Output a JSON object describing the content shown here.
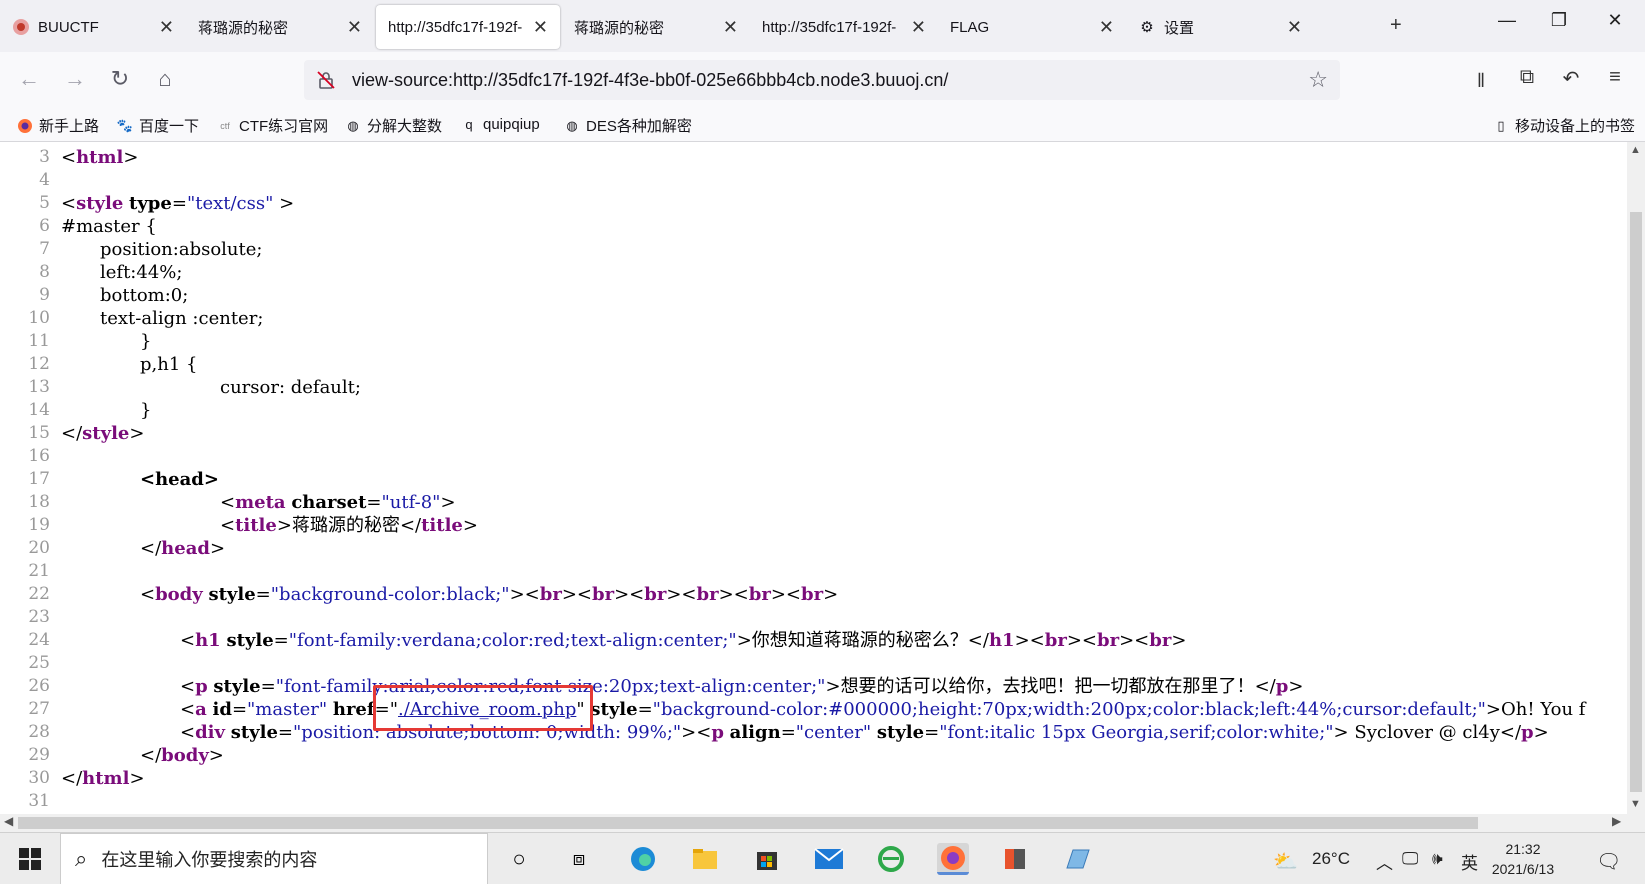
{
  "tabs": [
    {
      "title": "BUUCTF",
      "favicon": "buuctf-icon"
    },
    {
      "title": "蒋璐源的秘密",
      "favicon": ""
    },
    {
      "title": "http://35dfc17f-192f-",
      "favicon": "",
      "active": true
    },
    {
      "title": "蒋璐源的秘密",
      "favicon": ""
    },
    {
      "title": "http://35dfc17f-192f-",
      "favicon": ""
    },
    {
      "title": "FLAG",
      "favicon": ""
    },
    {
      "title": "设置",
      "favicon": "gear-icon"
    }
  ],
  "new_tab": "+",
  "url": "view-source:http://35dfc17f-192f-4f3e-bb0f-025e66bbb4cb.node3.buuoj.cn/",
  "bookmarks": [
    {
      "label": "新手上路",
      "icon": "firefox-icon"
    },
    {
      "label": "百度一下",
      "icon": "baidu-icon"
    },
    {
      "label": "CTF练习官网",
      "icon": "ctf-icon"
    },
    {
      "label": "分解大整数",
      "icon": "globe-icon"
    },
    {
      "label": "quipqiup",
      "icon": "q-icon"
    },
    {
      "label": "DES各种加解密",
      "icon": "globe-icon"
    }
  ],
  "mobile_bookmarks": "移动设备上的书签",
  "source_lines": {
    "l3": {
      "num": "3"
    },
    "l4": {
      "num": "4"
    },
    "l5": {
      "num": "5",
      "style_open": "style",
      "type_attr": "type",
      "type_val": "\"text/css\""
    },
    "l6": {
      "num": "6",
      "text": "#master {"
    },
    "l7": {
      "num": "7",
      "text": "position:absolute;"
    },
    "l8": {
      "num": "8",
      "text": "left:44%;"
    },
    "l9": {
      "num": "9",
      "text": "bottom:0;"
    },
    "l10": {
      "num": "10",
      "text": "text-align :center;"
    },
    "l11": {
      "num": "11",
      "text": "}"
    },
    "l12": {
      "num": "12",
      "text": "p,h1 {"
    },
    "l13": {
      "num": "13",
      "text": "cursor: default;"
    },
    "l14": {
      "num": "14",
      "text": "}"
    },
    "l15": {
      "num": "15",
      "text": "style"
    },
    "l16": {
      "num": "16"
    },
    "l17": {
      "num": "17",
      "text": "head"
    },
    "l18": {
      "num": "18",
      "tag": "meta",
      "attr": "charset",
      "val": "\"utf-8\""
    },
    "l19": {
      "num": "19",
      "tag": "title",
      "text": "蒋璐源的秘密"
    },
    "l20": {
      "num": "20",
      "text": "head"
    },
    "l21": {
      "num": "21"
    },
    "l22": {
      "num": "22",
      "tag": "body",
      "attr": "style",
      "val": "\"background-color:black;\"",
      "br": "br"
    },
    "l23": {
      "num": "23"
    },
    "l24": {
      "num": "24",
      "tag": "h1",
      "attr": "style",
      "val": "\"font-family:verdana;color:red;text-align:center;\"",
      "text": "你想知道蒋璐源的秘密么？"
    },
    "l25": {
      "num": "25"
    },
    "l26": {
      "num": "26",
      "tag": "p",
      "attr": "style",
      "val": "\"font-family:arial;color:red;font-size:20px;text-align:center;\"",
      "text": "想要的话可以给你，去找吧！把一切都放在那里了！"
    },
    "l27": {
      "num": "27",
      "tag": "a",
      "id_attr": "id",
      "id_val": "\"master\"",
      "href_attr": "href",
      "href_val": "./Archive_room.php",
      "style_attr": "style",
      "style_val": "\"background-color:#000000;height:70px;width:200px;color:black;left:44%;cursor:default;\"",
      "text": "Oh! You f"
    },
    "l28": {
      "num": "28",
      "tag": "div",
      "attr": "style",
      "val": "\"position: absolute;bottom: 0;width: 99%;\"",
      "p_align_attr": "align",
      "p_align_val": "\"center\"",
      "p_style_attr": "style",
      "p_style_val": "\"font:italic 15px Georgia,serif;color:white;\"",
      "text": " Syclover @ cl4y"
    },
    "l29": {
      "num": "29",
      "text": "body"
    },
    "l30": {
      "num": "30",
      "text": "html"
    },
    "l31": {
      "num": "31"
    }
  },
  "taskbar": {
    "search_placeholder": "在这里输入你要搜索的内容",
    "weather": "26°C",
    "ime": "英",
    "time": "21:32",
    "date": "2021/6/13"
  },
  "colors": {
    "highlight_box": "#e53935",
    "tag": "#7a0c7a",
    "value": "#1a1aa6"
  }
}
